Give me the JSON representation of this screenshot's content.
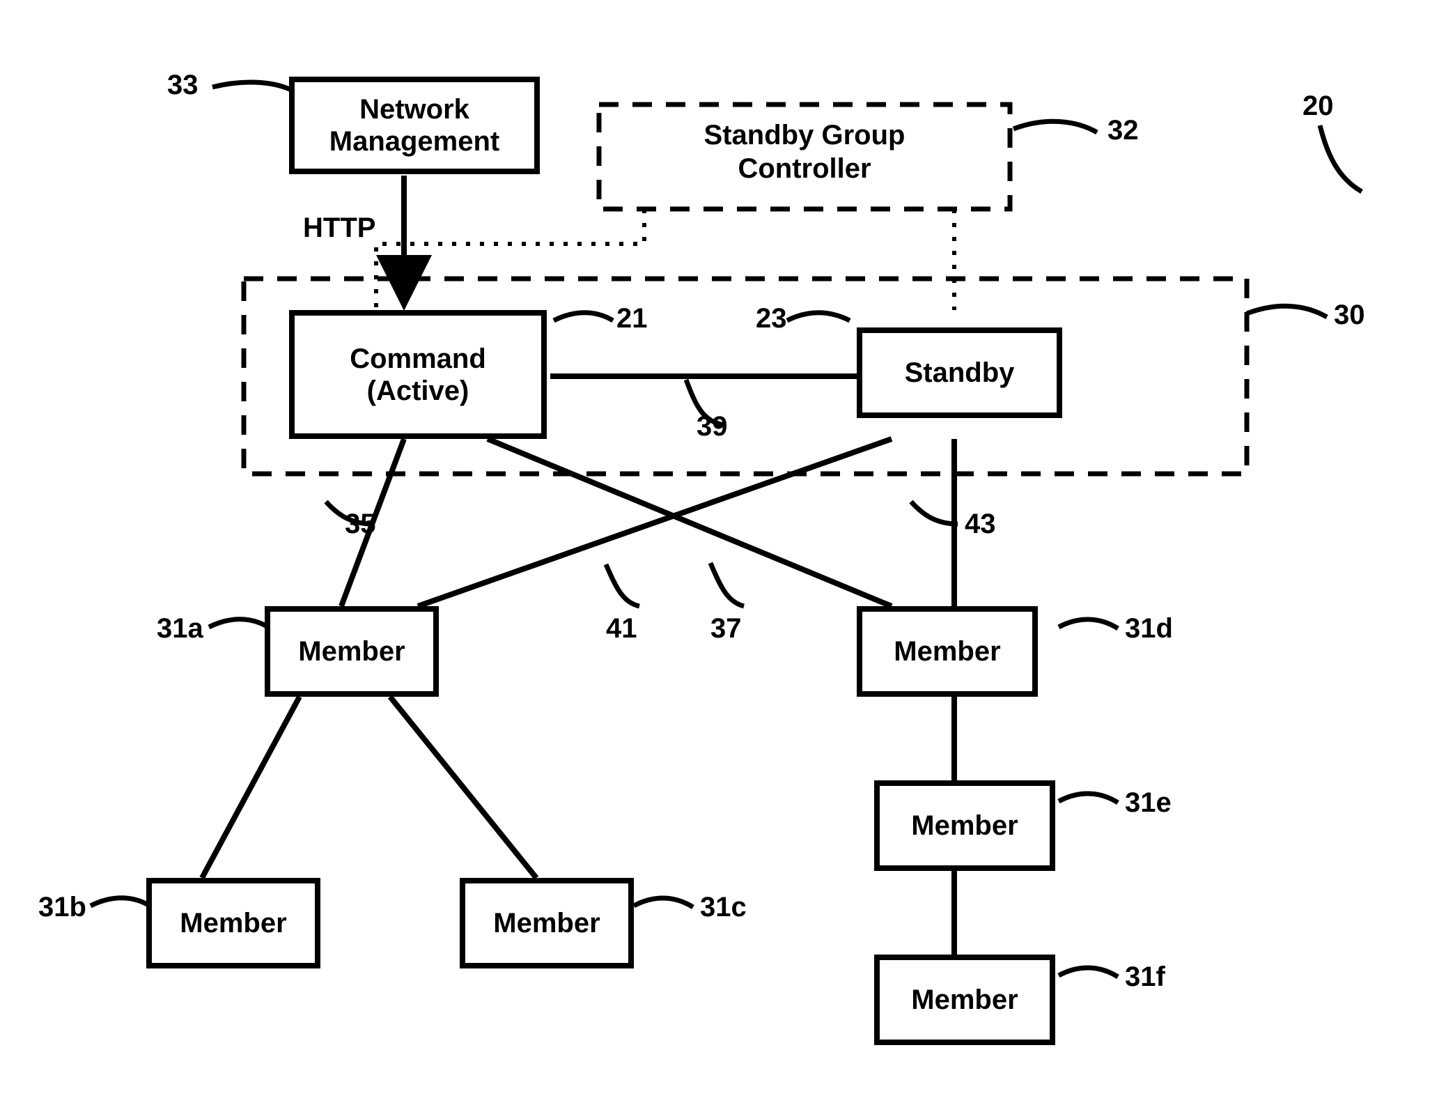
{
  "nodes": {
    "network_management": "Network\nManagement",
    "standby_group_controller": "Standby Group\nController",
    "command_active": "Command\n(Active)",
    "standby": "Standby",
    "member_a": "Member",
    "member_b": "Member",
    "member_c": "Member",
    "member_d": "Member",
    "member_e": "Member",
    "member_f": "Member"
  },
  "labels": {
    "http": "HTTP",
    "ref20": "20",
    "ref21": "21",
    "ref23": "23",
    "ref30": "30",
    "ref31a": "31a",
    "ref31b": "31b",
    "ref31c": "31c",
    "ref31d": "31d",
    "ref31e": "31e",
    "ref31f": "31f",
    "ref32": "32",
    "ref33": "33",
    "ref35": "35",
    "ref37": "37",
    "ref39": "39",
    "ref41": "41",
    "ref43": "43"
  }
}
